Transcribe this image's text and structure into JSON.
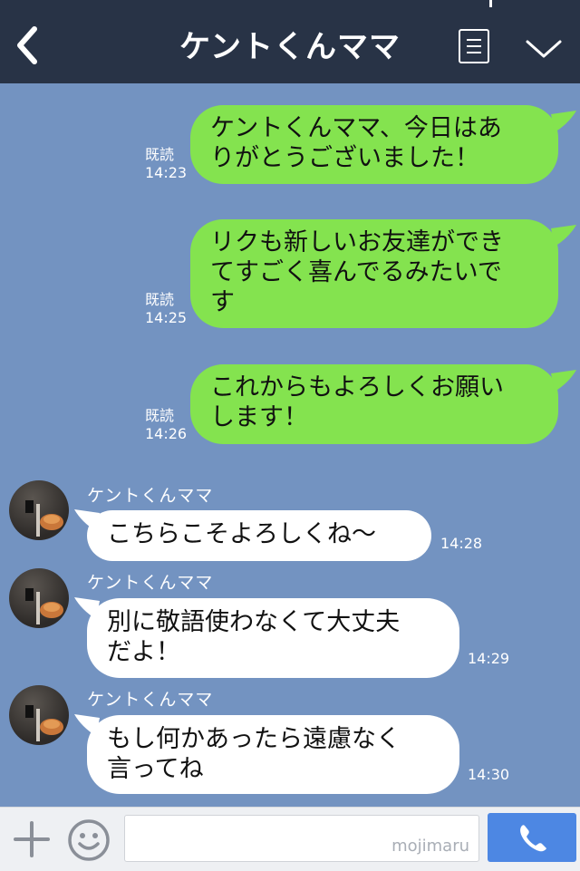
{
  "header": {
    "title": "ケントくんママ"
  },
  "sent_messages": [
    {
      "lines": [
        "ケントくんママ、今日はあ",
        "りがとうございました！"
      ],
      "read": "既読",
      "time": "14:23"
    },
    {
      "lines": [
        "リクも新しいお友達ができ",
        "てすごく喜んでるみたいで",
        "す"
      ],
      "read": "既読",
      "time": "14:25"
    },
    {
      "lines": [
        "これからもよろしくお願い",
        "します！"
      ],
      "read": "既読",
      "time": "14:26"
    }
  ],
  "received_messages": [
    {
      "sender": "ケントくんママ",
      "lines": [
        "こちらこそよろしくね〜"
      ],
      "time": "14:28"
    },
    {
      "sender": "ケントくんママ",
      "lines": [
        "別に敬語使わなくて大丈夫",
        "だよ！"
      ],
      "time": "14:29"
    },
    {
      "sender": "ケントくんママ",
      "lines": [
        "もし何かあったら遠慮なく",
        "言ってね"
      ],
      "time": "14:30"
    }
  ],
  "input_bar": {
    "watermark": "mojimaru"
  },
  "colors": {
    "background": "#7393c1",
    "header": "#283346",
    "sent_bubble": "#84e34f",
    "received_bubble": "#ffffff",
    "call_button": "#4d87e3"
  },
  "icons": {
    "back": "chevron-left-icon",
    "menu": "list-icon",
    "collapse": "chevron-down-icon",
    "add": "plus-icon",
    "emoji": "smiley-icon",
    "call": "phone-icon"
  }
}
